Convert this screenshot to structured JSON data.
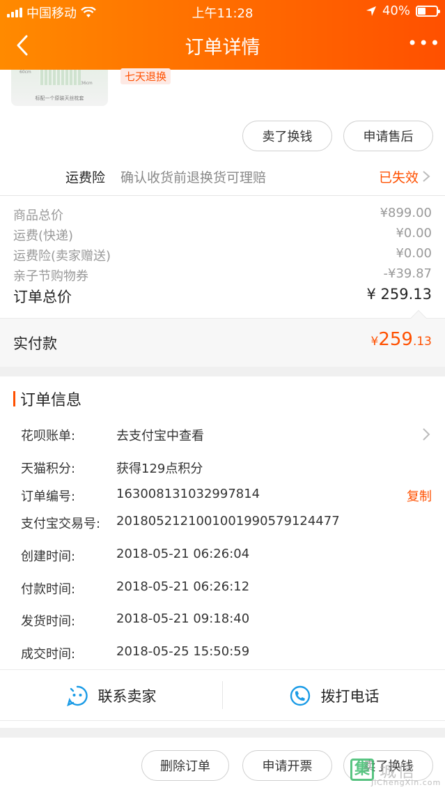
{
  "status_bar": {
    "carrier": "中国移动",
    "time": "上午11:28",
    "battery": "40%"
  },
  "nav": {
    "title": "订单详情",
    "more": "•••"
  },
  "product": {
    "tag": "七天退换",
    "caption": "标配一个原装天丝枕套",
    "dim_left": "60cm",
    "dim_right": "36cm"
  },
  "actions_top": {
    "sell": "卖了换钱",
    "after_sales": "申请售后"
  },
  "insurance": {
    "title": "运费险",
    "desc": "确认收货前退换货可理赔",
    "status": "已失效"
  },
  "fees": [
    {
      "label": "商品总价",
      "value": "¥899.00"
    },
    {
      "label": "运费(快递)",
      "value": "¥0.00"
    },
    {
      "label": "运费险(卖家赠送)",
      "value": "¥0.00"
    },
    {
      "label": "亲子节购物券",
      "value": "-¥39.87"
    }
  ],
  "total": {
    "label": "订单总价",
    "value": "¥ 259.13"
  },
  "paid": {
    "label": "实付款",
    "currency": "¥",
    "integer": "259",
    "decimal": ".13"
  },
  "order_info": {
    "title": "订单信息",
    "rows": [
      {
        "key": "花呗账单:",
        "value": "去支付宝中查看"
      },
      {
        "key": "天猫积分:",
        "value": "获得129点积分"
      },
      {
        "key": "订单编号:",
        "value": "163008131032997814",
        "action": "复制"
      },
      {
        "key": "支付宝交易号:",
        "value": "2018052121001001990579124477"
      },
      {
        "key": "创建时间:",
        "value": "2018-05-21 06:26:04"
      },
      {
        "key": "付款时间:",
        "value": "2018-05-21 06:26:12"
      },
      {
        "key": "发货时间:",
        "value": "2018-05-21 09:18:40"
      },
      {
        "key": "成交时间:",
        "value": "2018-05-25 15:50:59"
      }
    ]
  },
  "contact": {
    "seller": "联系卖家",
    "phone": "拨打电话"
  },
  "bottom_actions": {
    "delete": "删除订单",
    "invoice": "申请开票",
    "sell": "卖了换钱"
  },
  "watermark": {
    "mark": "集",
    "cn": "城信",
    "en": "JiChengXin.com"
  },
  "colors": {
    "accent": "#ff5000",
    "header_start": "#ff8a00",
    "icon_blue": "#1a9be6"
  }
}
